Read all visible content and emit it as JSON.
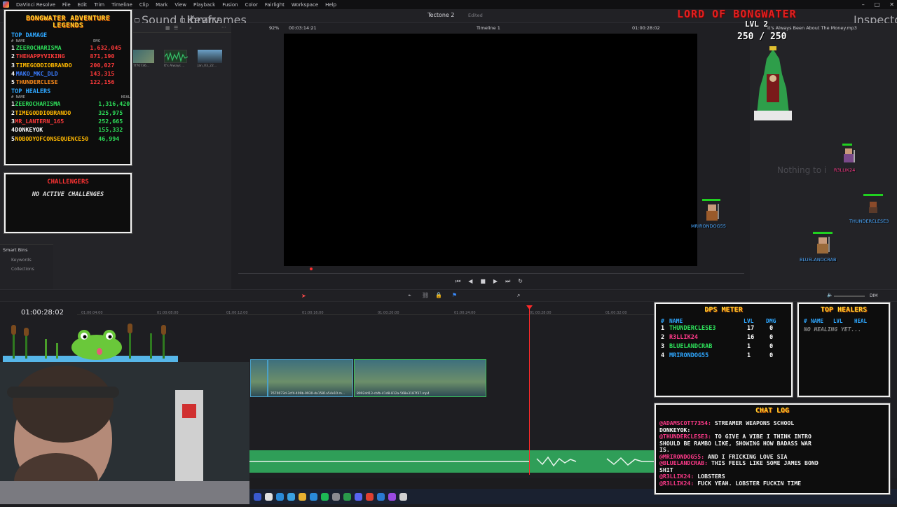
{
  "menubar": {
    "items": [
      "DaVinci Resolve",
      "File",
      "Edit",
      "Trim",
      "Timeline",
      "Clip",
      "Mark",
      "View",
      "Playback",
      "Fusion",
      "Color",
      "Fairlight",
      "Workspace",
      "Help"
    ]
  },
  "toolbar": {
    "sound_library": "Sound Library",
    "keyframes": "Keyframes",
    "project_title": "Tectone 2",
    "project_status": "Edited",
    "zoom": "92%",
    "source_timecode": "00:03:14:21",
    "timeline_name": "Timeline 1",
    "record_timecode": "01:00:28:02",
    "audio_file": "It's Always Been About The Money.mp3",
    "inspector": "Inspector"
  },
  "media_pool": {
    "thumbs": [
      "7f70736...",
      "It's Always ...",
      "Jan_03_22..."
    ],
    "smart_bins": "Smart Bins",
    "keywords": "Keywords",
    "collections": "Collections"
  },
  "inspector": {
    "empty_text": "Nothing to i"
  },
  "legends": {
    "title_line1": "BONGWATER ADVENTURE",
    "title_line2": "LEGENDS",
    "top_damage": "TOP DAMAGE",
    "hdr_name": "# NAME",
    "hdr_dmg": "DMG",
    "damage": [
      {
        "rank": "1",
        "name": "ZEEROCHARISMA",
        "value": "1,632,045",
        "name_color": "#2ee05a",
        "value_color": "#ff3a3a"
      },
      {
        "rank": "2",
        "name": "THEHAPPYVIKING",
        "value": "871,190",
        "name_color": "#ff3a3a",
        "value_color": "#ff3a3a"
      },
      {
        "rank": "3",
        "name": "TIMEGODDIOBRANDO",
        "value": "200,027",
        "name_color": "#ffb800",
        "value_color": "#ff3a3a"
      },
      {
        "rank": "4",
        "name": "MAKO_MKC_DLD",
        "value": "143,315",
        "name_color": "#3a7cff",
        "value_color": "#ff3a3a"
      },
      {
        "rank": "5",
        "name": "THUNDERCLESE",
        "value": "122,156",
        "name_color": "#ff8c1a",
        "value_color": "#ff3a3a"
      }
    ],
    "top_healers": "TOP HEALERS",
    "hdr_heal": "HEAL",
    "healers": [
      {
        "rank": "1",
        "name": "ZEEROCHARISMA",
        "value": "1,316,420",
        "name_color": "#2ee05a"
      },
      {
        "rank": "2",
        "name": "TIMEGODDIOBRANDO",
        "value": "325,975",
        "name_color": "#ffb800"
      },
      {
        "rank": "3",
        "name": "MR_LANTERN_165",
        "value": "252,665",
        "name_color": "#ff3a3a"
      },
      {
        "rank": "4",
        "name": "DONKEYOK",
        "value": "155,332",
        "name_color": "#ffffff"
      },
      {
        "rank": "5",
        "name": "NOBODYOFCONSEQUENCE50",
        "value": "46,994",
        "name_color": "#ffb800"
      }
    ]
  },
  "challengers": {
    "title": "CHALLENGERS",
    "status": "NO ACTIVE CHALLENGES"
  },
  "boss": {
    "title": "LORD OF BONGWATER",
    "level": "LVL 2",
    "hp": "250 / 250"
  },
  "sprites": [
    {
      "name": "R3LLIK24"
    },
    {
      "name": "MRIRONDOG55"
    },
    {
      "name": "THUNDERCLESE3"
    },
    {
      "name": "BLUELANDCRAB"
    }
  ],
  "timeline": {
    "timecode": "01:00:28:02",
    "ruler": [
      "01:00:04:00",
      "01:00:08:00",
      "01:00:12:00",
      "01:00:16:00",
      "01:00:20:00",
      "01:00:24:00",
      "01:00:28:00",
      "01:00:32:00"
    ],
    "clip1_label": "7670073d-3cf4-409b-9930-da1581a54e10.m...",
    "clip2_label": "8992dd13-cbfb-41d8-812a-568e3187f37.mp4",
    "dim": "DIM"
  },
  "dps_meter": {
    "title": "DPS METER",
    "hdr": [
      "#",
      "NAME",
      "LVL",
      "DMG"
    ],
    "rows": [
      {
        "rank": "1",
        "name": "THUNDERCLESE3",
        "lvl": "17",
        "dmg": "0",
        "color": "#2ee05a"
      },
      {
        "rank": "2",
        "name": "R3LLIK24",
        "lvl": "16",
        "dmg": "0",
        "color": "#ff3a8a"
      },
      {
        "rank": "3",
        "name": "BLUELANDCRAB",
        "lvl": "1",
        "dmg": "0",
        "color": "#2ee05a"
      },
      {
        "rank": "4",
        "name": "MRIRONDOG55",
        "lvl": "1",
        "dmg": "0",
        "color": "#2fa7ff"
      }
    ]
  },
  "top_healers_panel": {
    "title": "TOP HEALERS",
    "hdr": [
      "#",
      "NAME",
      "LVL",
      "HEAL"
    ],
    "empty": "NO HEALING YET..."
  },
  "chat": {
    "title": "CHAT LOG",
    "lines": [
      {
        "user": "@ADAMSCOTT7354:",
        "text": " STREAMER WEAPONS SCHOOL",
        "ucls": "u2"
      },
      {
        "user": "DONKEYOK:",
        "text": "",
        "ucls": ""
      },
      {
        "user": "@THUNDERCLESE3:",
        "text": " TO GIVE A VIBE I THINK INTRO",
        "ucls": "u2"
      },
      {
        "user": "",
        "text": "SHOULD BE RAMBO LIKE, SHOWING HOW BADASS WAR",
        "ucls": ""
      },
      {
        "user": "",
        "text": "IS.",
        "ucls": ""
      },
      {
        "user": "@MRIRONDOG55:",
        "text": " AND I FRICKING LOVE SIA",
        "ucls": "u2"
      },
      {
        "user": "@BLUELANDCRAB:",
        "text": " THIS FEELS LIKE SOME JAMES BOND",
        "ucls": "u2"
      },
      {
        "user": "",
        "text": "SHIT",
        "ucls": ""
      },
      {
        "user": "@R3LLIK24:",
        "text": " LOBSTERS",
        "ucls": "u2"
      },
      {
        "user": "@R3LLIK24:",
        "text": " FUCK YEAH. LOBSTER FUCKIN TIME",
        "ucls": "u2"
      }
    ]
  }
}
